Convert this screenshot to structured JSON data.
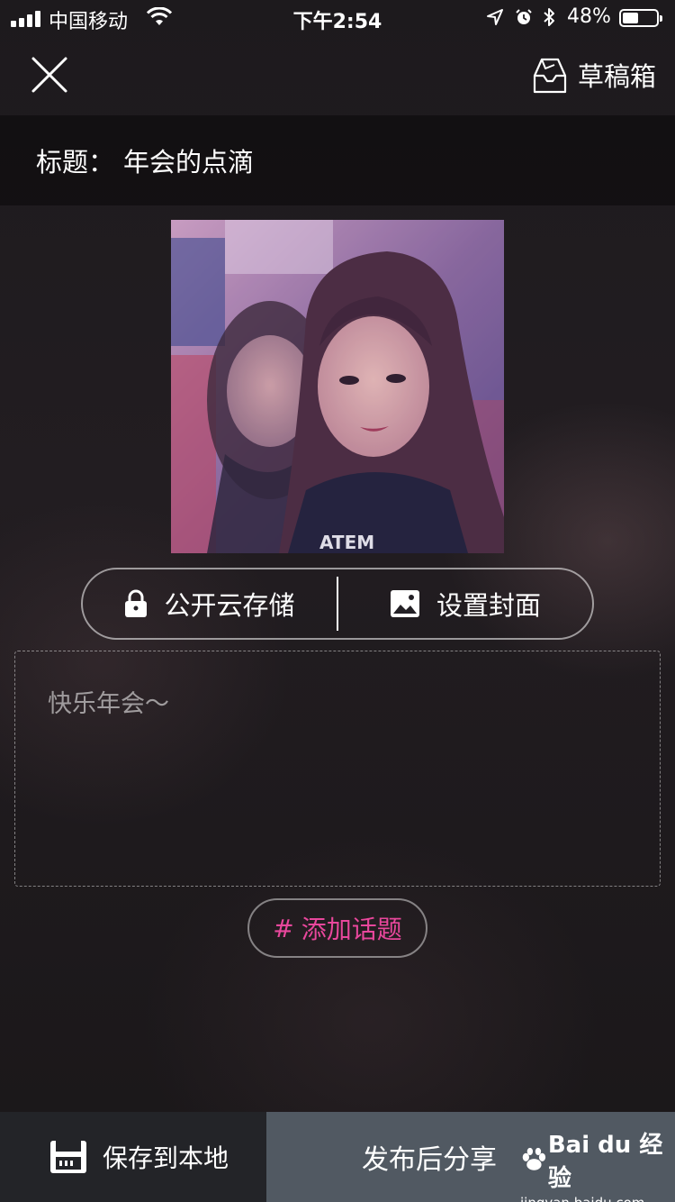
{
  "status_bar": {
    "carrier": "中国移动",
    "time": "下午2:54",
    "battery_percent": "48%",
    "battery_level": 0.48
  },
  "nav": {
    "drafts_label": "草稿箱"
  },
  "title_bar": {
    "label": "标题：",
    "value": "年会的点滴"
  },
  "actions": {
    "cloud_storage_label": "公开云存储",
    "set_cover_label": "设置封面"
  },
  "description": {
    "text": "快乐年会～"
  },
  "topic": {
    "hash": "#",
    "label": "添加话题"
  },
  "bottom_bar": {
    "save_local_label": "保存到本地",
    "publish_label": "发布后分享"
  },
  "watermark": {
    "brand": "Bai du 经验",
    "url": "jingyan.baidu.com"
  },
  "colors": {
    "accent": "#e8479c",
    "publish_bg": "#515962",
    "save_bg": "#232428"
  },
  "icons": [
    "signal-icon",
    "wifi-icon",
    "location-icon",
    "alarm-icon",
    "bluetooth-icon",
    "battery-icon",
    "close-icon",
    "drafts-icon",
    "lock-icon",
    "image-icon",
    "save-disk-icon",
    "paw-icon"
  ]
}
